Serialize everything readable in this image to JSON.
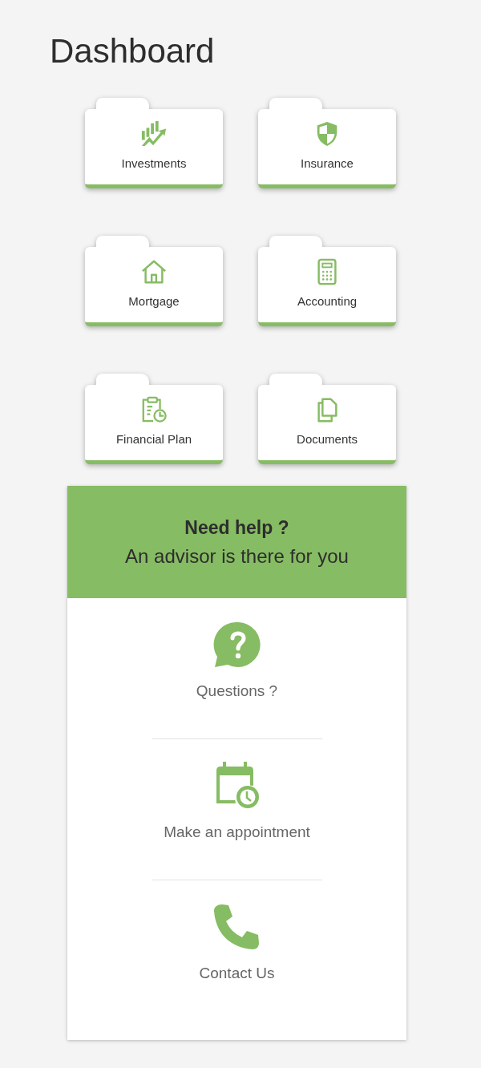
{
  "title": "Dashboard",
  "tiles": [
    {
      "label": "Investments",
      "kind": "chart"
    },
    {
      "label": "Insurance",
      "kind": "shield"
    },
    {
      "label": "Mortgage",
      "kind": "house"
    },
    {
      "label": "Accounting",
      "kind": "calculator"
    },
    {
      "label": "Financial Plan",
      "kind": "clipboard"
    },
    {
      "label": "Documents",
      "kind": "files"
    }
  ],
  "help": {
    "heading": "Need help ?",
    "subheading": "An advisor is there for you",
    "items": [
      {
        "label": "Questions ?",
        "kind": "question"
      },
      {
        "label": "Make an appointment",
        "kind": "calendar"
      },
      {
        "label": "Contact Us",
        "kind": "phone"
      }
    ]
  }
}
